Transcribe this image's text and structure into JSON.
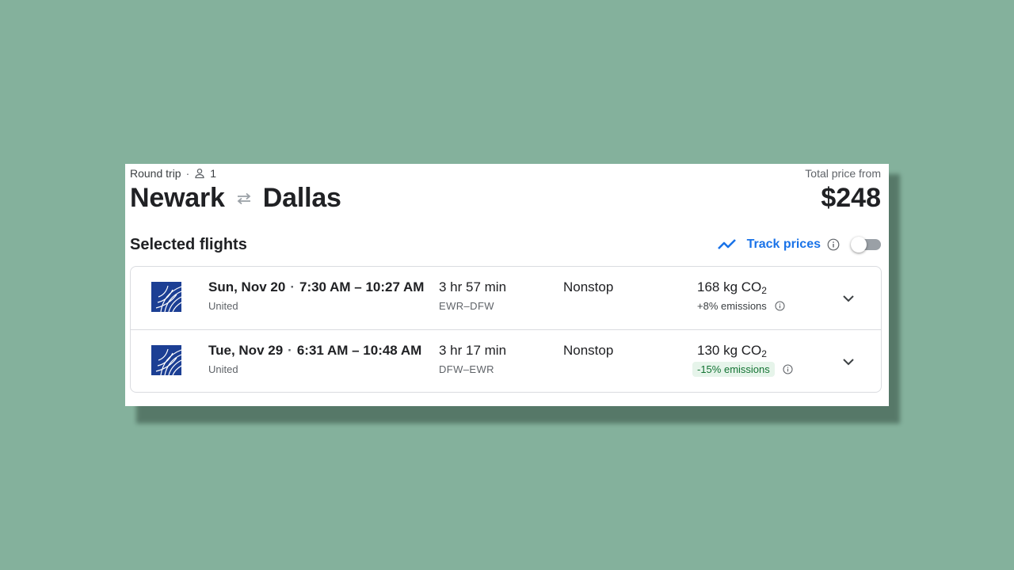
{
  "trip": {
    "type": "Round trip",
    "separator": "·",
    "passengers": "1",
    "origin": "Newark",
    "destination": "Dallas"
  },
  "price": {
    "label": "Total price from",
    "amount": "$248"
  },
  "selected": {
    "title": "Selected flights",
    "track_label": "Track prices",
    "track_enabled": false
  },
  "colors": {
    "accent": "#1a73e8",
    "background": "#84b19c",
    "badge_bg": "#e6f4ea",
    "badge_text": "#137333"
  },
  "flights": [
    {
      "date": "Sun, Nov 20",
      "times": "7:30 AM – 10:27 AM",
      "airline": "United",
      "duration": "3 hr 57 min",
      "airports": "EWR–DFW",
      "stops": "Nonstop",
      "co2_value": "168 kg CO",
      "co2_sub": "2",
      "emissions": "+8% emissions",
      "emissions_badge": false,
      "logo_icon": "united-globe-icon"
    },
    {
      "date": "Tue, Nov 29",
      "times": "6:31 AM – 10:48 AM",
      "airline": "United",
      "duration": "3 hr 17 min",
      "airports": "DFW–EWR",
      "stops": "Nonstop",
      "co2_value": "130 kg CO",
      "co2_sub": "2",
      "emissions": "-15% emissions",
      "emissions_badge": true,
      "logo_icon": "united-globe-icon"
    }
  ]
}
